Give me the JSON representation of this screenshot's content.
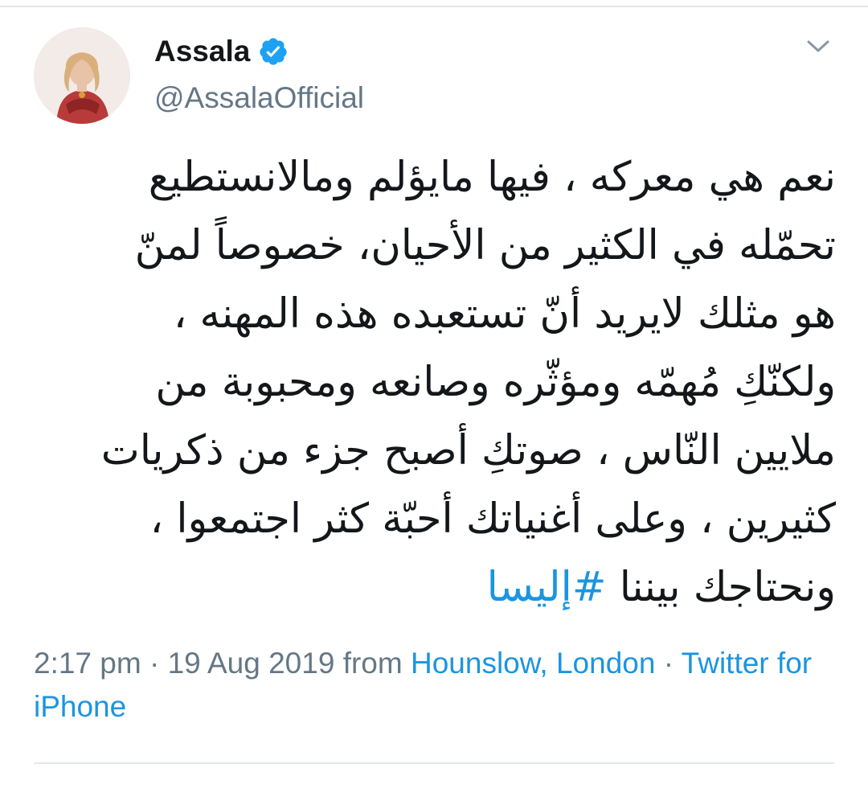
{
  "user": {
    "display_name": "Assala",
    "handle": "@AssalaOfficial",
    "verified": true
  },
  "tweet": {
    "lines": [
      "نعم هي معركه ، فيها مايؤلم ومالانستطيع",
      "تحمّله في الكثير من الأحيان، خصوصاً لمنّ",
      "هو مثلك لايريد أنّ تستعبده هذه المهنه ،",
      "ولكنّكِ مُهمّه ومؤثّره وصانعه ومحبوبة من",
      "ملايين النّاس ، صوتكِ أصبح جزء من ذكريات",
      "كثيرين ، وعلى أغنياتك أحبّة كثر اجتمعوا ،"
    ],
    "last_line_text": "ونحتاجك بيننا ",
    "hashtag": "#إليسا"
  },
  "meta": {
    "time": "2:17 pm",
    "separator": " · ",
    "date": "19 Aug 2019",
    "from_label": " from ",
    "location": "Hounslow, London",
    "client": "Twitter for iPhone"
  },
  "colors": {
    "accent": "#1b95e0",
    "secondary_text": "#657786",
    "divider": "#e1e8ed"
  },
  "icons": {
    "verified": "verified-badge-icon",
    "menu": "chevron-down-icon"
  }
}
